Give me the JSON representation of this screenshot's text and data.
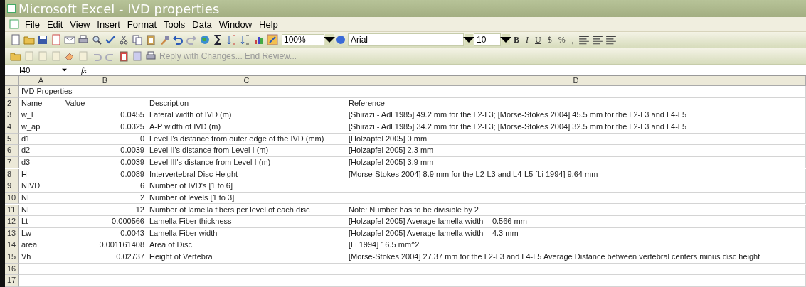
{
  "window": {
    "title": "Microsoft Excel - IVD properties"
  },
  "menu": [
    "File",
    "Edit",
    "View",
    "Insert",
    "Format",
    "Tools",
    "Data",
    "Window",
    "Help"
  ],
  "toolbar": {
    "zoom": "100%",
    "font": "Arial",
    "size": "10",
    "format_buttons": [
      {
        "label": "B",
        "kind": "bold"
      },
      {
        "label": "I",
        "kind": "italic"
      },
      {
        "label": "U",
        "kind": "underline"
      },
      {
        "label": "$",
        "kind": "plain"
      },
      {
        "label": "%",
        "kind": "plain"
      },
      {
        "label": ",",
        "kind": "plain"
      }
    ]
  },
  "review_toolbar": {
    "reply": "Reply with Changes...",
    "end": "End Review..."
  },
  "formula_bar": {
    "name_box": "I40",
    "fx": "fx"
  },
  "sheet": {
    "columns": [
      "A",
      "B",
      "C",
      "D"
    ],
    "rows": [
      {
        "n": "1",
        "cells": [
          "IVD Properties",
          "",
          "",
          ""
        ]
      },
      {
        "n": "2",
        "cells": [
          "Name",
          "Value",
          "Description",
          "Reference"
        ]
      },
      {
        "n": "3",
        "cells": [
          "w_l",
          "0.0455",
          "Lateral width of IVD (m)",
          "[Shirazi - Adl 1985] 49.2 mm for the L2-L3; [Morse-Stokes 2004] 45.5 mm for the L2-L3 and L4-L5"
        ]
      },
      {
        "n": "4",
        "cells": [
          "w_ap",
          "0.0325",
          "A-P width of IVD (m)",
          "[Shirazi - Adl 1985] 34.2 mm for the L2-L3; [Morse-Stokes 2004] 32.5 mm for the L2-L3 and L4-L5"
        ]
      },
      {
        "n": "5",
        "cells": [
          "d1",
          "0",
          "Level I's distance from outer edge of the IVD (mm)",
          "[Holzapfel 2005] 0 mm"
        ]
      },
      {
        "n": "6",
        "cells": [
          "d2",
          "0.0039",
          "Level II's distance from Level I (m)",
          "[Holzapfel 2005] 2.3 mm"
        ]
      },
      {
        "n": "7",
        "cells": [
          "d3",
          "0.0039",
          "Level III's distance from Level I (m)",
          "[Holzapfel 2005] 3.9 mm"
        ]
      },
      {
        "n": "8",
        "cells": [
          "H",
          "0.0089",
          "Intervertebral Disc Height",
          "[Morse-Stokes 2004] 8.9 mm for the L2-L3 and L4-L5 [Li 1994] 9.64 mm"
        ]
      },
      {
        "n": "9",
        "cells": [
          "NIVD",
          "6",
          "Number of IVD's [1 to 6]",
          ""
        ]
      },
      {
        "n": "10",
        "cells": [
          "NL",
          "2",
          "Number of levels [1 to 3]",
          ""
        ]
      },
      {
        "n": "11",
        "cells": [
          "NF",
          "12",
          "Number of lamella fibers per level of each disc",
          "Note: Number has to be divisible by 2"
        ]
      },
      {
        "n": "12",
        "cells": [
          "Lt",
          "0.000566",
          "Lamella Fiber thickness",
          "[Holzapfel 2005] Average lamella width = 0.566 mm"
        ]
      },
      {
        "n": "13",
        "cells": [
          "Lw",
          "0.0043",
          "Lamella Fiber width",
          "[Holzapfel 2005] Average lamella width = 4.3 mm"
        ]
      },
      {
        "n": "14",
        "cells": [
          "area",
          "0.001161408",
          "Area of Disc",
          "[Li 1994] 16.5 mm^2"
        ]
      },
      {
        "n": "15",
        "cells": [
          "Vh",
          "0.02737",
          "Height of Vertebra",
          "[Morse-Stokes 2004] 27.37 mm for the L2-L3 and L4-L5 Average Distance between vertebral centers minus disc height"
        ]
      },
      {
        "n": "16",
        "cells": [
          "",
          "",
          "",
          ""
        ]
      },
      {
        "n": "17",
        "cells": [
          "",
          "",
          "",
          ""
        ]
      }
    ]
  }
}
